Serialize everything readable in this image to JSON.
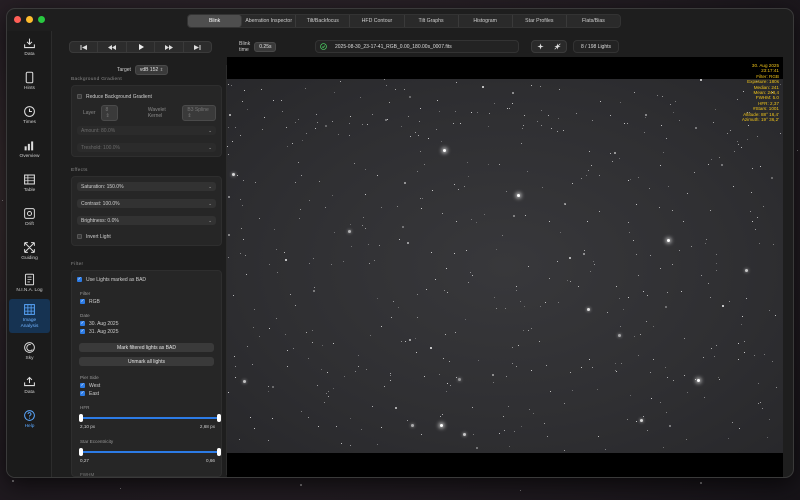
{
  "window": {
    "traffic_lights": [
      "#ff5f57",
      "#febc2e",
      "#28c840"
    ]
  },
  "tabs": [
    {
      "label": "Blink",
      "active": true
    },
    {
      "label": "Aberration Inspector",
      "active": false
    },
    {
      "label": "Tilt/Backfocus",
      "active": false
    },
    {
      "label": "HFD Contour",
      "active": false
    },
    {
      "label": "Tilt Graphs",
      "active": false
    },
    {
      "label": "Histogram",
      "active": false
    },
    {
      "label": "Star Profiles",
      "active": false
    },
    {
      "label": "Flats/Bias",
      "active": false
    }
  ],
  "sidebar": {
    "items": [
      {
        "label": "Data",
        "icon": "tray-download-icon",
        "active": false
      },
      {
        "label": "Hints",
        "icon": "phone-icon",
        "active": false
      },
      {
        "label": "Times",
        "icon": "clock-icon",
        "active": false
      },
      {
        "label": "Overview",
        "icon": "bar-chart-icon",
        "active": false
      },
      {
        "label": "Table",
        "icon": "table-icon",
        "active": false
      },
      {
        "label": "Drift",
        "icon": "target-icon",
        "active": false
      },
      {
        "label": "Guiding",
        "icon": "arrows-expand-icon",
        "active": false
      },
      {
        "label": "N.I.N.A. Log",
        "icon": "document-icon",
        "active": false
      },
      {
        "label": "Image Analysis",
        "icon": "grid-icon",
        "active": true
      },
      {
        "label": "Sky",
        "icon": "moon-icon",
        "active": false
      },
      {
        "label": "Data",
        "icon": "tray-upload-icon",
        "active": false
      },
      {
        "label": "Help",
        "icon": "question-icon",
        "active": false
      }
    ],
    "accent": "#2c7be5"
  },
  "toolbar": {
    "transport_icons": [
      "skip-back-icon",
      "step-back-icon",
      "play-icon",
      "step-forward-icon",
      "skip-forward-icon"
    ],
    "blink_time_label": "Blink time",
    "blink_time_value": "0.25s",
    "file_name": "2025-08-30_23-17-41_RGB_0.00_180.00s_0007.fits",
    "lights_counter": "8 / 198 Lights"
  },
  "panel": {
    "target_label": "Target",
    "target_value": "vdB 152",
    "background_gradient": {
      "title": "Background Gradient",
      "reduce_label": "Reduce Background Gradient",
      "reduce_checked": false,
      "layer_label": "Layer",
      "layer_value": "8",
      "wavelet_label": "Wavelet Kernel",
      "wavelet_value": "B3 Spline",
      "amount": "Amount:  80.0%",
      "threshold": "Treshold:  100.0%"
    },
    "effects": {
      "title": "Effects",
      "saturation": "Saturation:  150.0%",
      "contrast": "Contrast:  100.0%",
      "brightness": "Brightness:  0.0%",
      "invert_label": "Invert Light",
      "invert_checked": false
    },
    "filter": {
      "title": "Filter",
      "use_bad_label": "Use Lights marked as BAD",
      "use_bad_checked": true,
      "filter_heading": "Filter",
      "filter_option": "RGB",
      "date_heading": "Date",
      "dates": [
        "30. Aug 2025",
        "31. Aug 2025"
      ],
      "mark_bad_button": "Mark filtered lights as BAD",
      "unmark_button": "Unmark all lights",
      "pier_heading": "Pier Side",
      "pier_options": [
        "West",
        "East"
      ],
      "hfr_heading": "HFR",
      "hfr_min": "2,10 px",
      "hfr_max": "2,68 px",
      "ecc_heading": "Star Eccentricity",
      "ecc_min": "0,27",
      "ecc_max": "0,66",
      "next_heading": "FWHM"
    }
  },
  "image": {
    "overlay_color": "#f0c419",
    "overlay_lines": [
      "30. Aug 2025",
      "23:17:41",
      "Filter: RGB",
      "Exposure: 180s",
      "Median: 241",
      "Mean: 248,4",
      "FWHM: 5.0",
      "HFR: 2,37",
      "#Stars: 1001",
      "Altitude: 88° 16,4'",
      "Azimuth: 19° 36,2'"
    ]
  }
}
